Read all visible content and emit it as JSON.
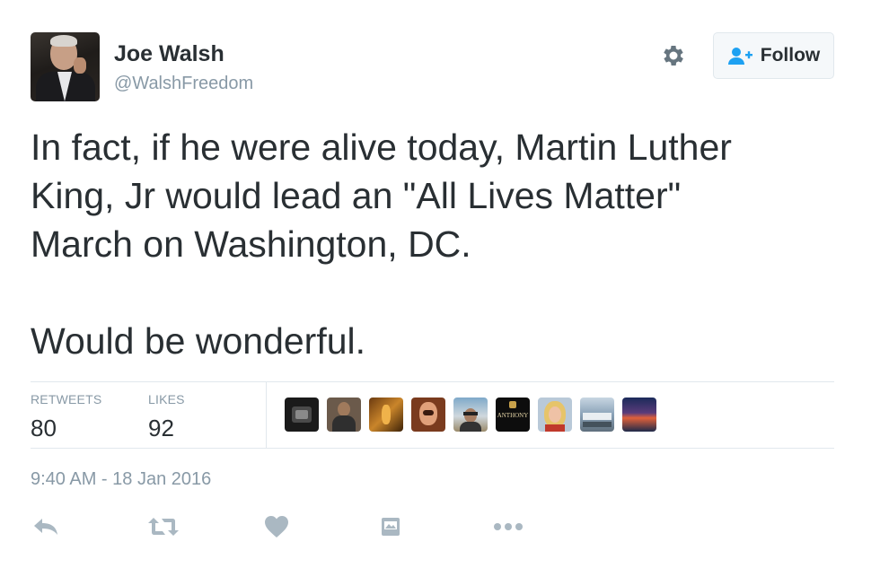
{
  "user": {
    "name": "Joe Walsh",
    "handle": "@WalshFreedom"
  },
  "follow_button": {
    "label": "Follow",
    "icon": "add-user-icon"
  },
  "settings": {
    "icon": "gear-icon"
  },
  "tweet": {
    "lines": [
      "In fact, if he were alive today, Martin Luther",
      "King, Jr would lead an \"All Lives Matter\"",
      "March on Washington, DC.",
      "Would be wonderful."
    ]
  },
  "stats": {
    "retweets_label": "RETWEETS",
    "retweets_value": "80",
    "likes_label": "LIKES",
    "likes_value": "92"
  },
  "likers": [
    {
      "name": "liker-avatar-1"
    },
    {
      "name": "liker-avatar-2"
    },
    {
      "name": "liker-avatar-3"
    },
    {
      "name": "liker-avatar-4"
    },
    {
      "name": "liker-avatar-5"
    },
    {
      "name": "liker-avatar-6",
      "text": "ANTHONY"
    },
    {
      "name": "liker-avatar-7"
    },
    {
      "name": "liker-avatar-8"
    },
    {
      "name": "liker-avatar-9"
    }
  ],
  "timestamp": "9:40 AM - 18 Jan 2016",
  "actions": [
    {
      "name": "reply-icon"
    },
    {
      "name": "retweet-icon"
    },
    {
      "name": "like-icon"
    },
    {
      "name": "moments-icon"
    },
    {
      "name": "more-icon"
    }
  ],
  "colors": {
    "text": "#292f33",
    "secondary": "#8899a6",
    "divider": "#e1e8ed",
    "action_icon": "#aab8c2",
    "follow_accent": "#1da1f2"
  }
}
